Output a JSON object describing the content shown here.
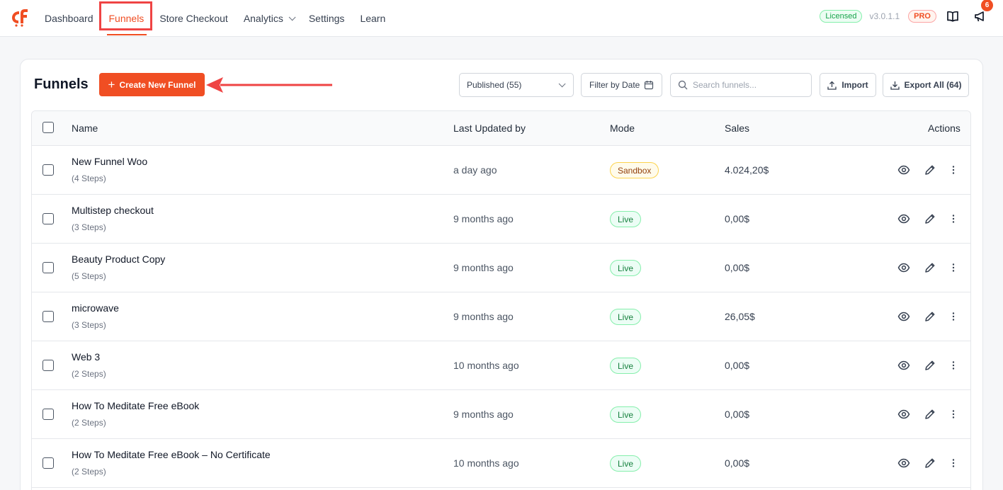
{
  "nav": {
    "items": [
      {
        "label": "Dashboard"
      },
      {
        "label": "Funnels"
      },
      {
        "label": "Store Checkout"
      },
      {
        "label": "Analytics"
      },
      {
        "label": "Settings"
      },
      {
        "label": "Learn"
      }
    ],
    "active": "Funnels"
  },
  "header_right": {
    "licensed": "Licensed",
    "version": "v3.0.1.1",
    "pro": "PRO",
    "notifications": "6"
  },
  "page": {
    "title": "Funnels",
    "create_label": "Create New Funnel",
    "status_filter": "Published (55)",
    "date_filter": "Filter by Date",
    "search_placeholder": "Search funnels...",
    "import_label": "Import",
    "export_label": "Export All (64)"
  },
  "table": {
    "columns": [
      "Name",
      "Last Updated by",
      "Mode",
      "Sales",
      "Actions"
    ],
    "rows": [
      {
        "name": "New Funnel Woo",
        "steps": "(4 Steps)",
        "updated": "a day ago",
        "mode": "Sandbox",
        "sales": "4.024,20$"
      },
      {
        "name": "Multistep checkout",
        "steps": "(3 Steps)",
        "updated": "9 months ago",
        "mode": "Live",
        "sales": "0,00$"
      },
      {
        "name": "Beauty Product Copy",
        "steps": "(5 Steps)",
        "updated": "9 months ago",
        "mode": "Live",
        "sales": "0,00$"
      },
      {
        "name": "microwave",
        "steps": "(3 Steps)",
        "updated": "9 months ago",
        "mode": "Live",
        "sales": "26,05$"
      },
      {
        "name": "Web 3",
        "steps": "(2 Steps)",
        "updated": "10 months ago",
        "mode": "Live",
        "sales": "0,00$"
      },
      {
        "name": "How To Meditate Free eBook",
        "steps": "(2 Steps)",
        "updated": "9 months ago",
        "mode": "Live",
        "sales": "0,00$"
      },
      {
        "name": "How To Meditate Free eBook – No Certificate",
        "steps": "(2 Steps)",
        "updated": "10 months ago",
        "mode": "Live",
        "sales": "0,00$"
      }
    ]
  },
  "colors": {
    "accent": "#f04e23",
    "annotation": "#ef4444",
    "live": "#15803d",
    "sandbox": "#92400e"
  }
}
